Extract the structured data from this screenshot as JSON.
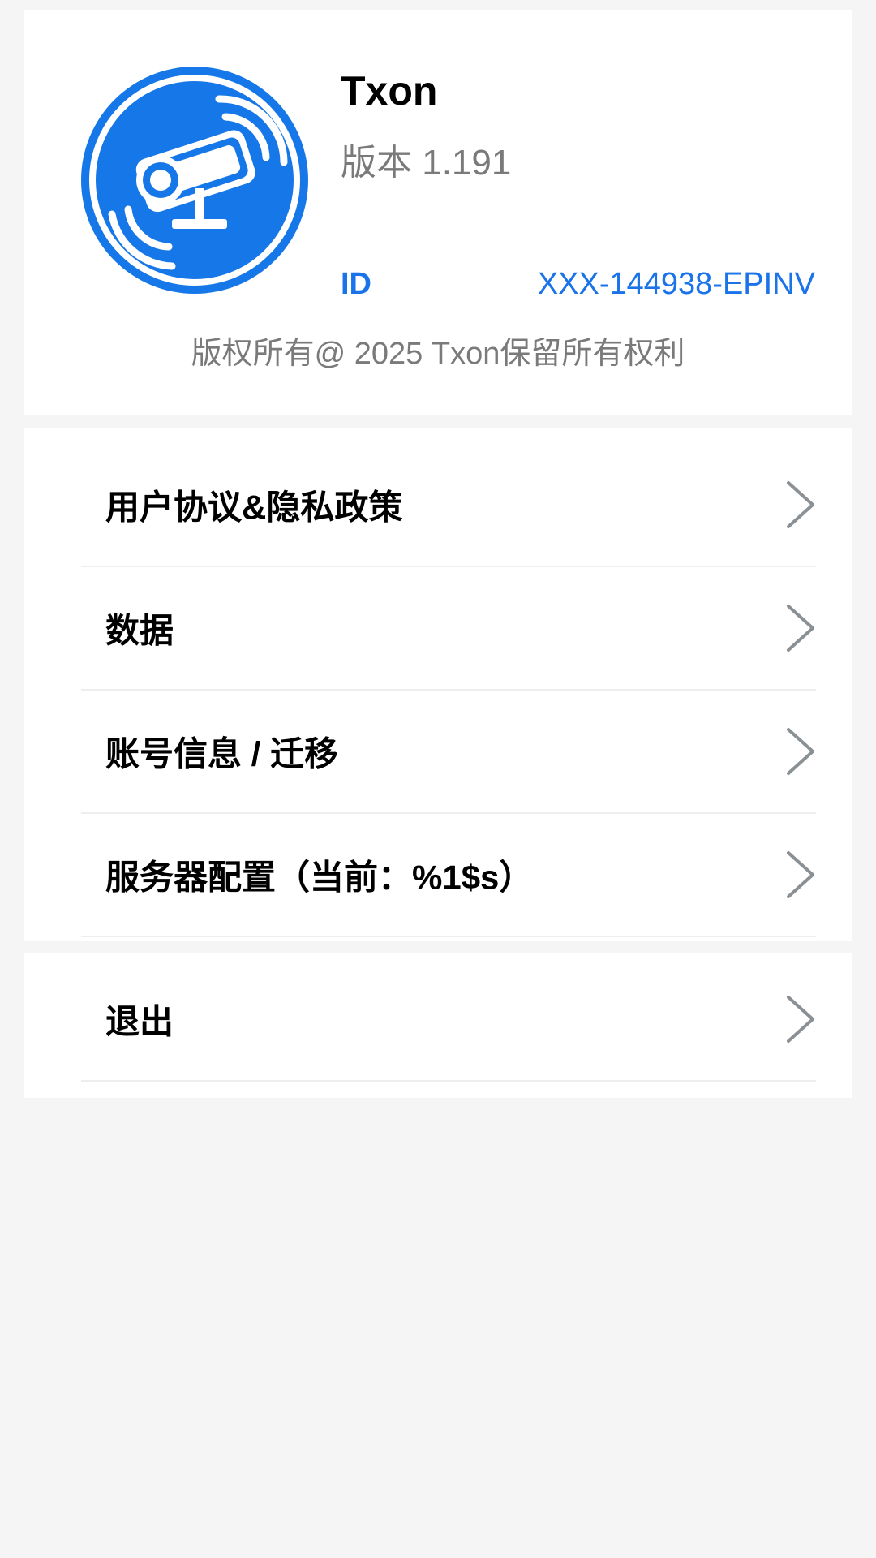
{
  "about": {
    "app_name": "Txon",
    "version": "版本 1.191",
    "id_label": "ID",
    "id_value": "XXX-144938-EPINV",
    "copyright": "版权所有@ 2025 Txon保留所有权利"
  },
  "menu": {
    "items": [
      {
        "label": "用户协议&隐私政策"
      },
      {
        "label": "数据"
      },
      {
        "label": "账号信息 / 迁移"
      },
      {
        "label": "服务器配置（当前：%1$s）"
      }
    ]
  },
  "logout": {
    "label": "退出"
  },
  "icons": {
    "app_logo": "security-camera-icon",
    "chevron": "chevron-right-icon"
  },
  "colors": {
    "accent": "#1a73e8",
    "logo_blue": "#1677e8",
    "background": "#f5f5f5",
    "card": "#ffffff",
    "secondary_text": "#7a7a7a",
    "chevron": "#8a9094"
  }
}
